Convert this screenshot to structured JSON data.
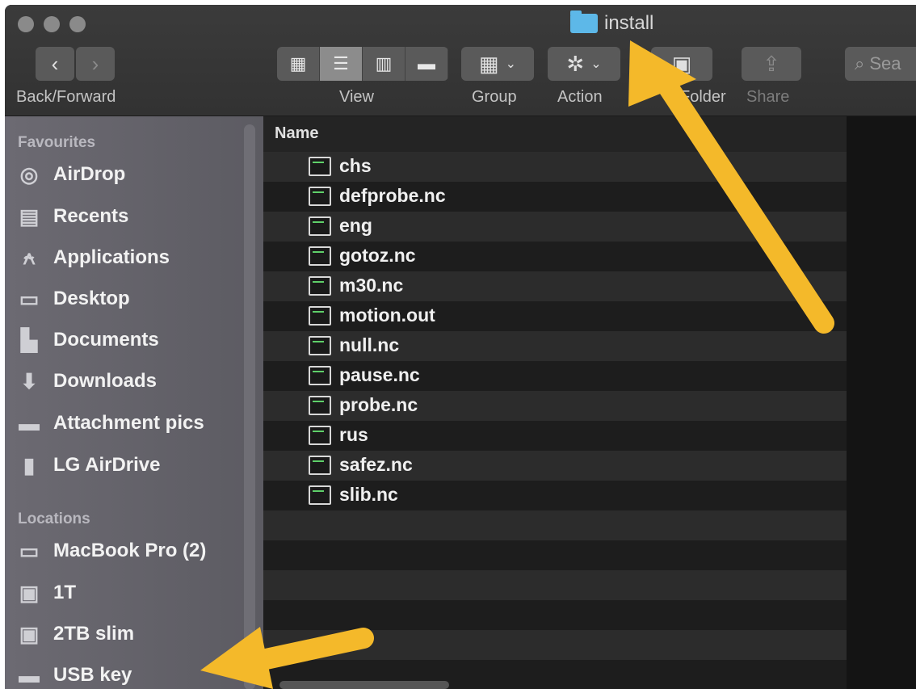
{
  "window": {
    "title": "install"
  },
  "toolbar": {
    "back_forward_label": "Back/Forward",
    "view_label": "View",
    "group_label": "Group",
    "action_label": "Action",
    "new_folder_label": "Folder",
    "share_label": "Share",
    "search_placeholder": "Sea"
  },
  "sidebar": {
    "favourites_heading": "Favourites",
    "favourites": [
      {
        "label": "AirDrop",
        "icon": "airdrop-icon"
      },
      {
        "label": "Recents",
        "icon": "recents-icon"
      },
      {
        "label": "Applications",
        "icon": "applications-icon"
      },
      {
        "label": "Desktop",
        "icon": "desktop-icon"
      },
      {
        "label": "Documents",
        "icon": "documents-icon"
      },
      {
        "label": "Downloads",
        "icon": "downloads-icon"
      },
      {
        "label": "Attachment pics",
        "icon": "folder-icon"
      },
      {
        "label": "LG AirDrive",
        "icon": "document-icon"
      }
    ],
    "locations_heading": "Locations",
    "locations": [
      {
        "label": "MacBook Pro (2)",
        "icon": "laptop-icon"
      },
      {
        "label": "1T",
        "icon": "disk-icon"
      },
      {
        "label": "2TB slim",
        "icon": "disk-icon"
      },
      {
        "label": "USB key",
        "icon": "usb-drive-icon"
      }
    ]
  },
  "file_list": {
    "column_name": "Name",
    "files": [
      "chs",
      "defprobe.nc",
      "eng",
      "gotoz.nc",
      "m30.nc",
      "motion.out",
      "null.nc",
      "pause.nc",
      "probe.nc",
      "rus",
      "safez.nc",
      "slib.nc"
    ]
  },
  "colors": {
    "arrow": "#f4b92a",
    "folder": "#5db8e8"
  }
}
